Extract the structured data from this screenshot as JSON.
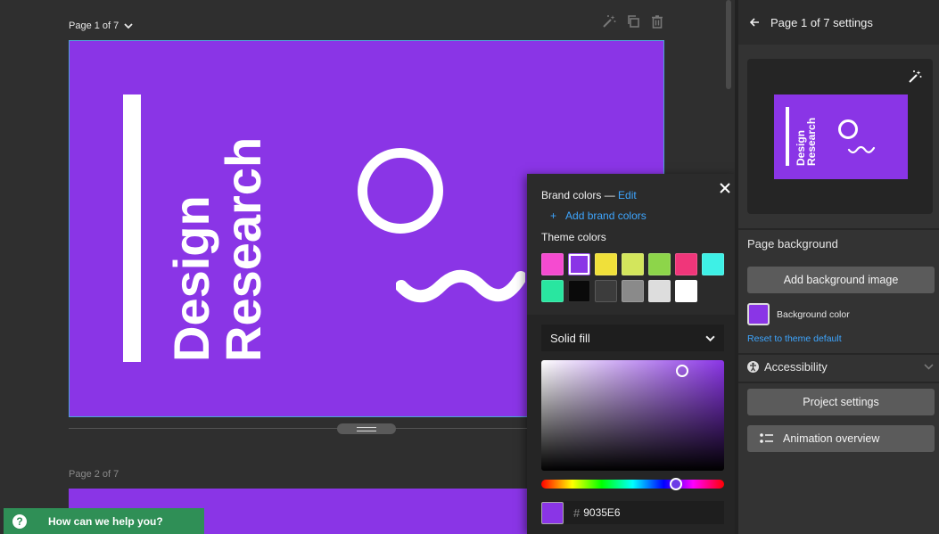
{
  "canvas": {
    "page1_label": "Page 1 of 7",
    "page2_label": "Page 2 of 7",
    "slide": {
      "title_line1": "Design",
      "title_line2": "Research",
      "background": "#8A35E6"
    }
  },
  "color_popup": {
    "brand_colors_label": "Brand colors —",
    "edit_label": "Edit",
    "add_brand_plus": "+",
    "add_brand_label": "Add brand colors",
    "theme_colors_label": "Theme colors",
    "theme_colors": [
      "#F54BD0",
      "#8A35E6",
      "#F0E03A",
      "#D3E65C",
      "#8DD54A",
      "#F0367A",
      "#3EF0E6",
      "#29E6A0",
      "#0A0A0A",
      "#3C3C3C",
      "#8A8A8A",
      "#DDDDDD",
      "#FFFFFF"
    ],
    "selected_swatch_index": 1,
    "fill_type": "Solid fill",
    "hash_symbol": "#",
    "hex_value": "9035E6"
  },
  "panel": {
    "title": "Page 1 of 7 settings",
    "thumbnail_title_line1": "Design",
    "thumbnail_title_line2": "Research",
    "page_background_label": "Page background",
    "add_background_image_label": "Add background image",
    "background_color_label": "Background color",
    "reset_label": "Reset to theme default",
    "accessibility_label": "Accessibility",
    "project_settings_label": "Project settings",
    "animation_overview_label": "Animation overview"
  },
  "help": {
    "icon_text": "?",
    "label": "How can we help you?",
    "color": "#2F8F56"
  }
}
